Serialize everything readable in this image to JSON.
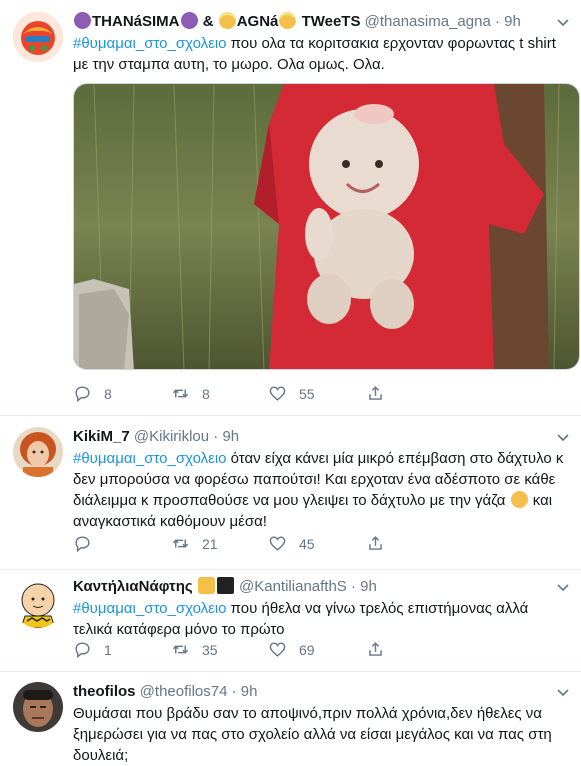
{
  "tweets": [
    {
      "display_name_a": "THANáSIMA",
      "display_name_b": "AGNá",
      "display_name_c": "TWeeTS",
      "amp": "&",
      "handle": "@thanasima_agna",
      "time": "9h",
      "hashtag": "#θυμαμαι_στο_σχολειο",
      "text": " που ολα τα κοριτσακια ερχονταν φορωντας t shirt με την σταμπα αυτη, το μωρο. Ολα ομως. Ολα.",
      "replies": "8",
      "retweets": "8",
      "likes": "55"
    },
    {
      "display_name": "KikiM_7",
      "handle": "@Kikiriklou",
      "time": "9h",
      "hashtag": "#θυμαμαι_στο_σχολειο",
      "text_a": " όταν είχα κάνει μία μικρό επέμβαση στο δάχτυλο κ δεν μπορούσα να φορέσω παπούτσι! Και ερχοταν ένα αδέσποτο σε κάθε διάλειμμα κ προσπαθούσε να μου γλειψει το δάχτυλο με την γάζα ",
      "text_b": " και αναγκαστικά καθόμουν μέσα!",
      "replies": "",
      "retweets": "21",
      "likes": "45"
    },
    {
      "display_name": "ΚαντήλιαΝάφτης",
      "handle": "@KantilianafthS",
      "time": "9h",
      "hashtag": "#θυμαμαι_στο_σχολειο",
      "text": " που ήθελα να γίνω τρελός επιστήμονας αλλά τελικά κατάφερα μόνο το πρώτο",
      "replies": "1",
      "retweets": "35",
      "likes": "69"
    },
    {
      "display_name": "theofilos",
      "handle": "@theofilos74",
      "time": "9h",
      "text": "Θυμάσαι που βράδυ σαν το αποψινό,πριν πολλά χρόνια,δεν ήθελες να ξημερώσει για να πας στο σχολείο αλλά να είσαι μεγάλος και να πας στη δουλειά;"
    }
  ],
  "dot": "·",
  "colors": {
    "accent": "#1b95e0",
    "secondary": "#657786",
    "border": "#e6ecf0"
  }
}
